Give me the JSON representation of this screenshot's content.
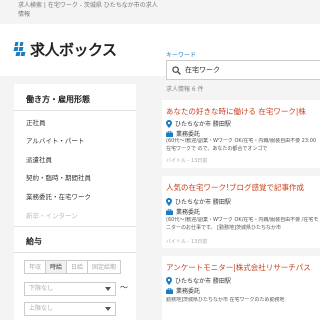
{
  "header": {
    "breadcrumb": "求人検索 | 在宅ワーク - 茨城県 ひたちなか市の求人情報",
    "logo_text": "求人ボックス",
    "keyword_label": "キーワード",
    "search_value": "在宅ワーク"
  },
  "sidebar": {
    "work_style_heading": "働き方・雇用形態",
    "work_styles": [
      "正社員",
      "アルバイト・パート",
      "派遣社員",
      "契約・臨時・期間社員",
      "業務委託・在宅ワーク",
      "新卒・インターン"
    ],
    "salary_heading": "給与",
    "pay_periods": [
      "年収",
      "時給",
      "日給",
      "固定給期"
    ],
    "selected_pay_period": "時給",
    "min_placeholder": "下限なし",
    "max_placeholder": "上限なし",
    "range_separator": "〜"
  },
  "results": {
    "count_text": "求人情報 6 件",
    "jobs": [
      {
        "title": "あなたの好きな時に働ける 在宅ワーク|株",
        "location": "ひたちなか市 勝田駅",
        "type": "業務委託",
        "description": "(60代〜)歓迎/副業・Wワーク OK/在宅・内職/服装自由不要 23:00 在宅ワークで ので、あなたの都合でオンゴで",
        "source": "バイトル - 13日前"
      },
      {
        "title": "人気の在宅ワーク!ブログ感覚で記事作成",
        "location": "ひたちなか市 勝田駅",
        "type": "業務委託",
        "description": "(60代〜)歓迎/副業・Wワーク OK/在宅・内職/服装自由不要 /在宅モニターのお仕事です。 [勤務地]茨城県ひたちなか市",
        "source": "バイトル - 13日前"
      },
      {
        "title": "アンケートモニター|株式会社リサーチパス",
        "location": "ひたちなか市 勝田駅",
        "type": "業務委託",
        "description": "勤務地]茨城県ひたちなか市 在宅ワークのため勤務地",
        "source": ""
      }
    ]
  },
  "colors": {
    "brand": "#1a7cc3",
    "job_title": "#c8401e"
  }
}
